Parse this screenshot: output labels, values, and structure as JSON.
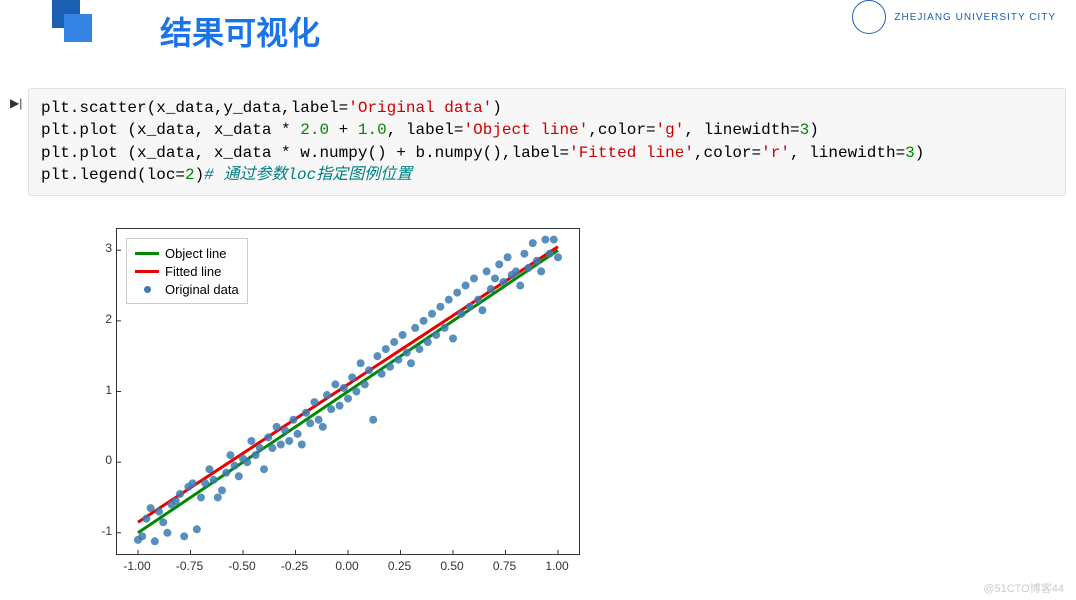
{
  "header": {
    "title": "结果可视化",
    "university": "ZHEJIANG UNIVERSITY CITY"
  },
  "code_lines": [
    {
      "raw": "plt.scatter(x_data,y_data,label='Original data')"
    },
    {
      "raw": "plt.plot (x_data, x_data * 2.0 + 1.0, label='Object line',color='g', linewidth=3)"
    },
    {
      "raw": "plt.plot (x_data, x_data * w.numpy() + b.numpy(),label='Fitted line',color='r', linewidth=3)"
    },
    {
      "raw": "plt.legend(loc=2)# 通过参数loc指定图例位置"
    }
  ],
  "legend": {
    "object": "Object line",
    "fitted": "Fitted line",
    "original": "Original data"
  },
  "watermark": "@51CTO博客",
  "page_num": "44",
  "chart_data": {
    "type": "scatter+line",
    "xlim": [
      -1.1,
      1.1
    ],
    "ylim": [
      -1.3,
      3.3
    ],
    "xticks": [
      -1.0,
      -0.75,
      -0.5,
      -0.25,
      0.0,
      0.25,
      0.5,
      0.75,
      1.0
    ],
    "yticks": [
      -1,
      0,
      1,
      2,
      3
    ],
    "series": [
      {
        "name": "Object line",
        "type": "line",
        "color": "#008800",
        "width": 3,
        "x": [
          -1,
          1
        ],
        "y": [
          -1,
          3
        ]
      },
      {
        "name": "Fitted line",
        "type": "line",
        "color": "#e60000",
        "width": 3,
        "x": [
          -1,
          1
        ],
        "y": [
          -0.85,
          3.05
        ]
      },
      {
        "name": "Original data",
        "type": "scatter",
        "color": "#3b7bb0",
        "points": [
          [
            -1.0,
            -1.1
          ],
          [
            -0.98,
            -1.05
          ],
          [
            -0.96,
            -0.8
          ],
          [
            -0.94,
            -0.65
          ],
          [
            -0.92,
            -1.12
          ],
          [
            -0.9,
            -0.7
          ],
          [
            -0.88,
            -0.85
          ],
          [
            -0.86,
            -1.0
          ],
          [
            -0.84,
            -0.6
          ],
          [
            -0.82,
            -0.55
          ],
          [
            -0.8,
            -0.45
          ],
          [
            -0.78,
            -1.05
          ],
          [
            -0.76,
            -0.35
          ],
          [
            -0.74,
            -0.3
          ],
          [
            -0.72,
            -0.95
          ],
          [
            -0.7,
            -0.5
          ],
          [
            -0.68,
            -0.3
          ],
          [
            -0.66,
            -0.1
          ],
          [
            -0.64,
            -0.25
          ],
          [
            -0.62,
            -0.5
          ],
          [
            -0.6,
            -0.4
          ],
          [
            -0.58,
            -0.15
          ],
          [
            -0.56,
            0.1
          ],
          [
            -0.54,
            -0.05
          ],
          [
            -0.52,
            -0.2
          ],
          [
            -0.5,
            0.05
          ],
          [
            -0.48,
            0.0
          ],
          [
            -0.46,
            0.3
          ],
          [
            -0.44,
            0.1
          ],
          [
            -0.42,
            0.2
          ],
          [
            -0.4,
            -0.1
          ],
          [
            -0.38,
            0.35
          ],
          [
            -0.36,
            0.2
          ],
          [
            -0.34,
            0.5
          ],
          [
            -0.32,
            0.25
          ],
          [
            -0.3,
            0.45
          ],
          [
            -0.28,
            0.3
          ],
          [
            -0.26,
            0.6
          ],
          [
            -0.24,
            0.4
          ],
          [
            -0.22,
            0.25
          ],
          [
            -0.2,
            0.7
          ],
          [
            -0.18,
            0.55
          ],
          [
            -0.16,
            0.85
          ],
          [
            -0.14,
            0.6
          ],
          [
            -0.12,
            0.5
          ],
          [
            -0.1,
            0.95
          ],
          [
            -0.08,
            0.75
          ],
          [
            -0.06,
            1.1
          ],
          [
            -0.04,
            0.8
          ],
          [
            -0.02,
            1.05
          ],
          [
            0.0,
            0.9
          ],
          [
            0.02,
            1.2
          ],
          [
            0.04,
            1.0
          ],
          [
            0.06,
            1.4
          ],
          [
            0.08,
            1.1
          ],
          [
            0.1,
            1.3
          ],
          [
            0.12,
            0.6
          ],
          [
            0.14,
            1.5
          ],
          [
            0.16,
            1.25
          ],
          [
            0.18,
            1.6
          ],
          [
            0.2,
            1.35
          ],
          [
            0.22,
            1.7
          ],
          [
            0.24,
            1.45
          ],
          [
            0.26,
            1.8
          ],
          [
            0.28,
            1.55
          ],
          [
            0.3,
            1.4
          ],
          [
            0.32,
            1.9
          ],
          [
            0.34,
            1.6
          ],
          [
            0.36,
            2.0
          ],
          [
            0.38,
            1.7
          ],
          [
            0.4,
            2.1
          ],
          [
            0.42,
            1.8
          ],
          [
            0.44,
            2.2
          ],
          [
            0.46,
            1.9
          ],
          [
            0.48,
            2.3
          ],
          [
            0.5,
            1.75
          ],
          [
            0.52,
            2.4
          ],
          [
            0.54,
            2.1
          ],
          [
            0.56,
            2.5
          ],
          [
            0.58,
            2.2
          ],
          [
            0.6,
            2.6
          ],
          [
            0.62,
            2.3
          ],
          [
            0.64,
            2.15
          ],
          [
            0.66,
            2.7
          ],
          [
            0.68,
            2.45
          ],
          [
            0.7,
            2.6
          ],
          [
            0.72,
            2.8
          ],
          [
            0.74,
            2.55
          ],
          [
            0.76,
            2.9
          ],
          [
            0.78,
            2.65
          ],
          [
            0.8,
            2.7
          ],
          [
            0.82,
            2.5
          ],
          [
            0.84,
            2.95
          ],
          [
            0.86,
            2.75
          ],
          [
            0.88,
            3.1
          ],
          [
            0.9,
            2.85
          ],
          [
            0.92,
            2.7
          ],
          [
            0.94,
            3.15
          ],
          [
            0.96,
            2.95
          ],
          [
            0.98,
            3.15
          ],
          [
            1.0,
            2.9
          ]
        ]
      }
    ]
  }
}
